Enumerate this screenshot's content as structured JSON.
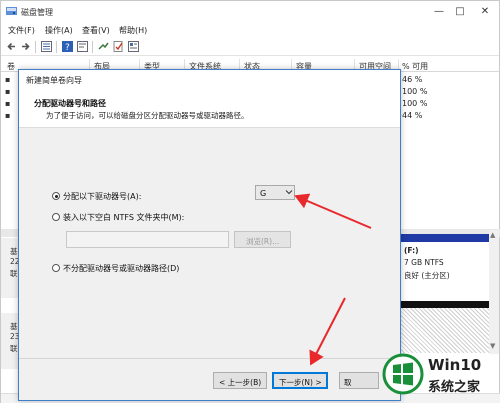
{
  "window": {
    "title": "磁盘管理",
    "controls": {
      "minimize": "—",
      "maximize": "□",
      "close": "✕"
    }
  },
  "menu": {
    "file": "文件(F)",
    "action": "操作(A)",
    "view": "查看(V)",
    "help": "帮助(H)"
  },
  "toolbar_icons": [
    "back-icon",
    "forward-icon",
    "list-icon",
    "help-icon",
    "properties-icon",
    "connect-icon",
    "check-icon",
    "view-icon"
  ],
  "volume_list": {
    "headers": [
      "卷",
      "布局",
      "类型",
      "文件系统",
      "状态",
      "容量",
      "可用空间",
      "% 可用"
    ],
    "percent_free": [
      "46 %",
      "100 %",
      "100 %",
      "44 %"
    ]
  },
  "graph_view": {
    "disk0_label_fragments": [
      "基",
      "22",
      "联"
    ],
    "disk1_label_fragments": [
      "基",
      "23",
      "联"
    ],
    "f_volume": {
      "name": "(F:)",
      "size": "7 GB NTFS",
      "status": "良好 (主分区)"
    }
  },
  "wizard": {
    "title": "新建简单卷向导",
    "header_title": "分配驱动器号和路径",
    "header_subtitle": "为了便于访问，可以给磁盘分区分配驱动器号或驱动器路径。",
    "options": {
      "assign_letter": "分配以下驱动器号(A):",
      "mount_folder": "装入以下空白 NTFS 文件夹中(M):",
      "no_assign": "不分配驱动器号或驱动器路径(D)"
    },
    "selected_option": "assign_letter",
    "drive_letter": "G",
    "browse_label": "浏览(R)...",
    "path_value": "",
    "back_label": "< 上一步(B)",
    "next_label": "下一步(N) >",
    "cancel_label": "取"
  },
  "watermark": {
    "brand": "Win10",
    "subtitle": "系统之家"
  },
  "colors": {
    "accent": "#0078d7",
    "arrow_red": "#e8282b",
    "f_volume_bar": "#1f3aa4",
    "watermark_ring": "#1a8f3a"
  }
}
